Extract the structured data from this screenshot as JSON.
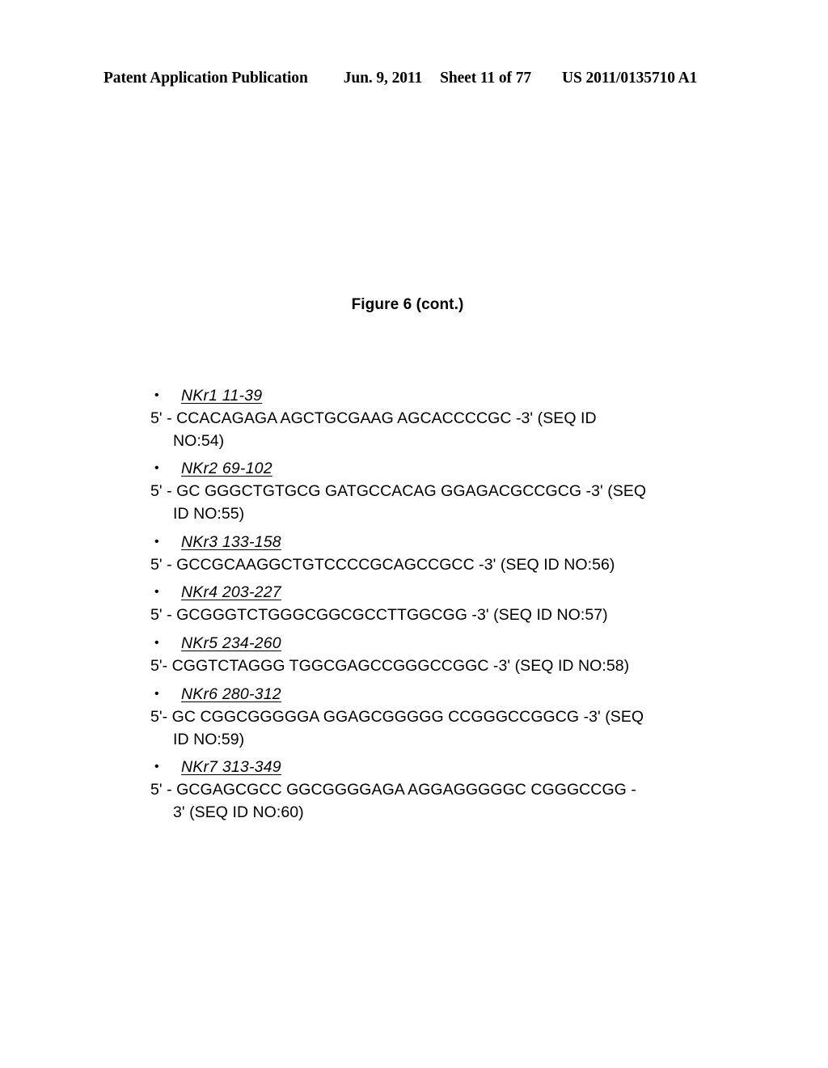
{
  "header": {
    "publication": "Patent Application Publication",
    "date": "Jun. 9, 2011",
    "sheet": "Sheet 11 of 77",
    "number": "US 2011/0135710 A1"
  },
  "figure": {
    "title": "Figure 6 (cont.)"
  },
  "list": {
    "bullet_glyph": "•",
    "entries": [
      {
        "label": "NKr1 11-39 ",
        "sequence_line1": "5' - CCACAGAGA AGCTGCGAAG AGCACCCCGC -3' (SEQ ID",
        "sequence_line2": "NO:54)"
      },
      {
        "label": "NKr2 69-102",
        "sequence_line1": "5' - GC GGGCTGTGCG GATGCCACAG GGAGACGCCGCG -3' (SEQ",
        "sequence_line2": "ID NO:55)"
      },
      {
        "label": "NKr3 133-158",
        "sequence_line1": "5' - GCCGCAAGGCTGTCCCCGCAGCCGCC -3' (SEQ ID NO:56)",
        "sequence_line2": ""
      },
      {
        "label": "NKr4 203-227",
        "sequence_line1": "5' - GCGGGTCTGGGCGGCGCCTTGGCGG -3' (SEQ ID NO:57)",
        "sequence_line2": ""
      },
      {
        "label": "NKr5 234-260",
        "sequence_line1": "5'- CGGTCTAGGG TGGCGAGCCGGGCCGGC -3' (SEQ ID NO:58)",
        "sequence_line2": ""
      },
      {
        "label": "NKr6 280-312",
        "sequence_line1": "5'- GC CGGCGGGGGA GGAGCGGGGG CCGGGCCGGCG -3' (SEQ",
        "sequence_line2": "ID NO:59)"
      },
      {
        "label": "NKr7 313-349",
        "sequence_line1": "5' - GCGAGCGCC GGCGGGGAGA AGGAGGGGGC CGGGCCGG -",
        "sequence_line2": "3' (SEQ ID NO:60)"
      }
    ]
  }
}
